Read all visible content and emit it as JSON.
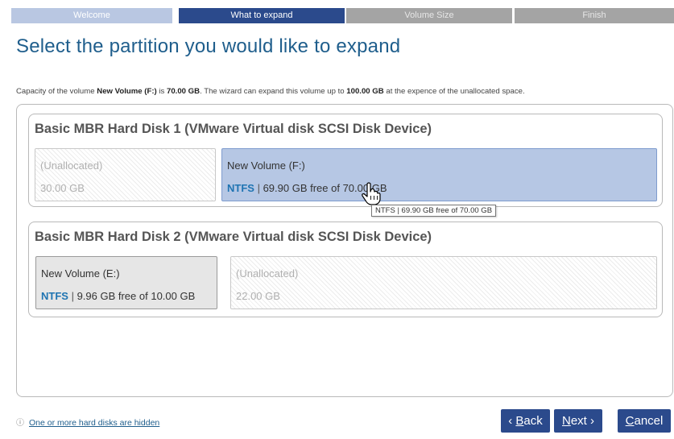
{
  "steps": [
    {
      "label": "Welcome",
      "state": "done"
    },
    {
      "label": "What to expand",
      "state": "active"
    },
    {
      "label": "Volume Size",
      "state": "pending"
    },
    {
      "label": "Finish",
      "state": "pending"
    }
  ],
  "page_title": "Select the partition you would like to expand",
  "description": {
    "part1": "Capacity of the volume ",
    "volume": "New Volume (F:)",
    "part2": " is ",
    "capacity": "70.00 GB",
    "part3": ". The wizard can expand this volume up to ",
    "max": "100.00 GB",
    "part4": " at the expence of the unallocated space."
  },
  "disks": [
    {
      "title": "Basic MBR Hard Disk 1 (VMware Virtual disk SCSI Disk Device)",
      "partitions": [
        {
          "name": "(Unallocated)",
          "size": "30.00 GB",
          "type": "unallocated"
        },
        {
          "name": "New Volume (F:)",
          "fs": "NTFS",
          "sep": " | ",
          "info": "69.90 GB free of 70.00 GB",
          "type": "selected"
        }
      ]
    },
    {
      "title": "Basic MBR Hard Disk 2 (VMware Virtual disk SCSI Disk Device)",
      "partitions": [
        {
          "name": "New Volume (E:)",
          "fs": "NTFS",
          "sep": " | ",
          "info": "9.96 GB free of 10.00 GB",
          "type": "volume"
        },
        {
          "name": "(Unallocated)",
          "size": "22.00 GB",
          "type": "unallocated"
        }
      ]
    }
  ],
  "tooltip": "NTFS | 69.90 GB free of 70.00 GB",
  "hidden_note": {
    "icon": "info-icon",
    "glyph": "ⓘ",
    "link": "One or more hard disks are hidden"
  },
  "buttons": {
    "back": {
      "prefix": "‹ ",
      "key": "B",
      "rest": "ack"
    },
    "next": {
      "key": "N",
      "rest": "ext",
      "suffix": " ›"
    },
    "cancel": {
      "key": "C",
      "rest": "ancel"
    }
  },
  "colors": {
    "accent": "#2b4a8c",
    "title": "#1f5e8c",
    "selected": "#b6c7e4",
    "fs_label": "#1f74b2"
  }
}
